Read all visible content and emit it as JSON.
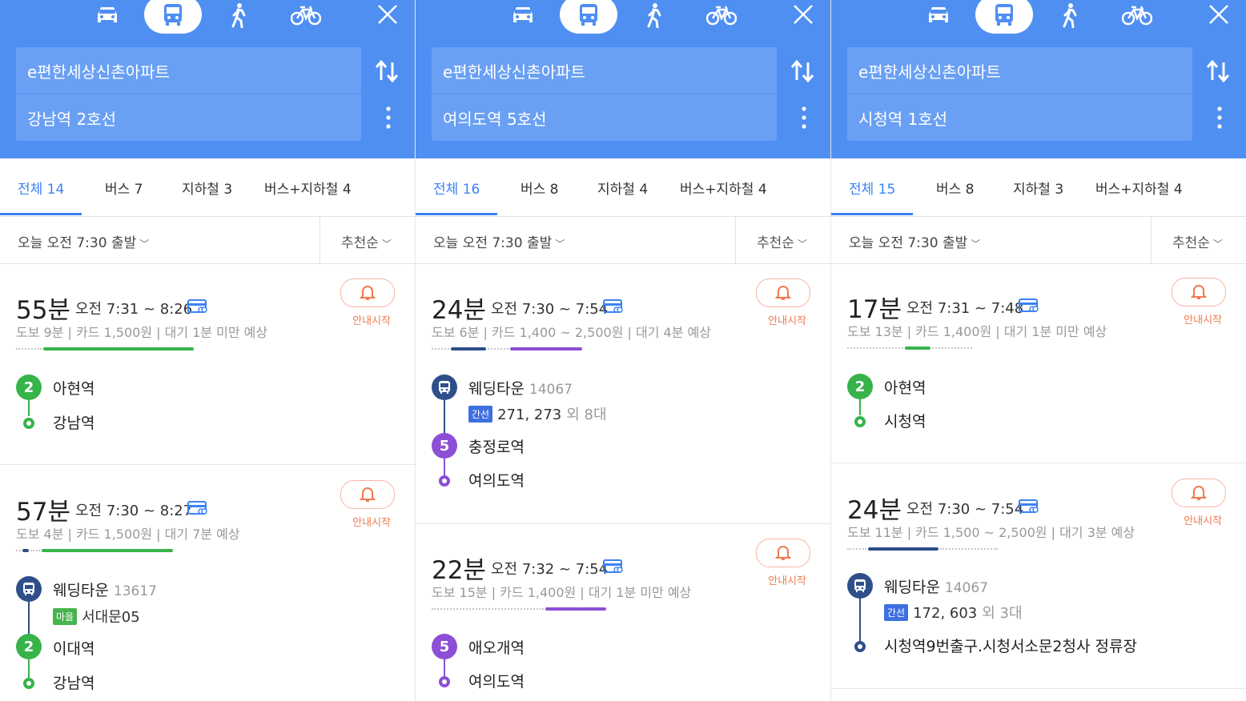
{
  "colors": {
    "header": "#4f8ff2",
    "active": "#3b82f6",
    "line2": "#37b34a",
    "line5": "#8c4fd6",
    "bus": "#2f4f8a",
    "alarm": "#ef7b4f",
    "village": "#47b34c",
    "trunk": "#3d6fe0"
  },
  "modes": [
    {
      "icon": "car-icon"
    },
    {
      "icon": "bus-icon",
      "active": true
    },
    {
      "icon": "walk-icon"
    },
    {
      "icon": "bike-icon"
    }
  ],
  "panels": [
    {
      "origin": "e편한세상신촌아파트",
      "destination": "강남역 2호선",
      "tabs": [
        {
          "label": "전체 14"
        },
        {
          "label": "버스 7"
        },
        {
          "label": "지하철 3"
        },
        {
          "label": "버스+지하철 4"
        }
      ],
      "departure": "오늘 오전 7:30 출발",
      "sort": "추천순",
      "routes": [
        {
          "duration": "55분",
          "time": "오전 7:31 ~ 8:26",
          "summary": "도보 9분 | 카드 1,500원 | 대기 1분 미만 예상",
          "alarm": "안내시작",
          "steps": [
            {
              "badge": "2",
              "name": "아현역"
            },
            {
              "name": "강남역"
            }
          ]
        },
        {
          "duration": "57분",
          "time": "오전 7:30 ~ 8:27",
          "summary": "도보 4분 | 카드 1,500원 | 대기 7분 예상",
          "alarm": "안내시작",
          "steps": [
            {
              "name": "웨딩타운",
              "stop_id": "13617",
              "tag": "마을",
              "route": "서대문05"
            },
            {
              "badge": "2",
              "name": "이대역"
            },
            {
              "name": "강남역"
            }
          ]
        }
      ]
    },
    {
      "origin": "e편한세상신촌아파트",
      "destination": "여의도역 5호선",
      "tabs": [
        {
          "label": "전체 16"
        },
        {
          "label": "버스 8"
        },
        {
          "label": "지하철 4"
        },
        {
          "label": "버스+지하철 4"
        }
      ],
      "departure": "오늘 오전 7:30 출발",
      "sort": "추천순",
      "routes": [
        {
          "duration": "24분",
          "time": "오전 7:30 ~ 7:54",
          "summary": "도보 6분 | 카드 1,400 ~ 2,500원 | 대기 4분 예상",
          "alarm": "안내시작",
          "steps": [
            {
              "name": "웨딩타운",
              "stop_id": "14067",
              "tag": "간선",
              "route": "271, 273",
              "extra": "외 8대"
            },
            {
              "badge": "5",
              "name": "충정로역"
            },
            {
              "name": "여의도역"
            }
          ]
        },
        {
          "duration": "22분",
          "time": "오전 7:32 ~ 7:54",
          "summary": "도보 15분 | 카드 1,400원 | 대기 1분 미만 예상",
          "alarm": "안내시작",
          "steps": [
            {
              "badge": "5",
              "name": "애오개역"
            },
            {
              "name": "여의도역"
            }
          ]
        }
      ]
    },
    {
      "origin": "e편한세상신촌아파트",
      "destination": "시청역 1호선",
      "tabs": [
        {
          "label": "전체 15"
        },
        {
          "label": "버스 8"
        },
        {
          "label": "지하철 3"
        },
        {
          "label": "버스+지하철 4"
        }
      ],
      "departure": "오늘 오전 7:30 출발",
      "sort": "추천순",
      "routes": [
        {
          "duration": "17분",
          "time": "오전 7:31 ~ 7:48",
          "summary": "도보 13분 | 카드 1,400원 | 대기 1분 미만 예상",
          "alarm": "안내시작",
          "steps": [
            {
              "badge": "2",
              "name": "아현역"
            },
            {
              "name": "시청역"
            }
          ]
        },
        {
          "duration": "24분",
          "time": "오전 7:30 ~ 7:54",
          "summary": "도보 11분 | 카드 1,500 ~ 2,500원 | 대기 3분 예상",
          "alarm": "안내시작",
          "steps": [
            {
              "name": "웨딩타운",
              "stop_id": "14067",
              "tag": "간선",
              "route": "172, 603",
              "extra": "외 3대"
            },
            {
              "name": "시청역9번출구.시청서소문2청사 정류장"
            }
          ]
        }
      ]
    }
  ]
}
